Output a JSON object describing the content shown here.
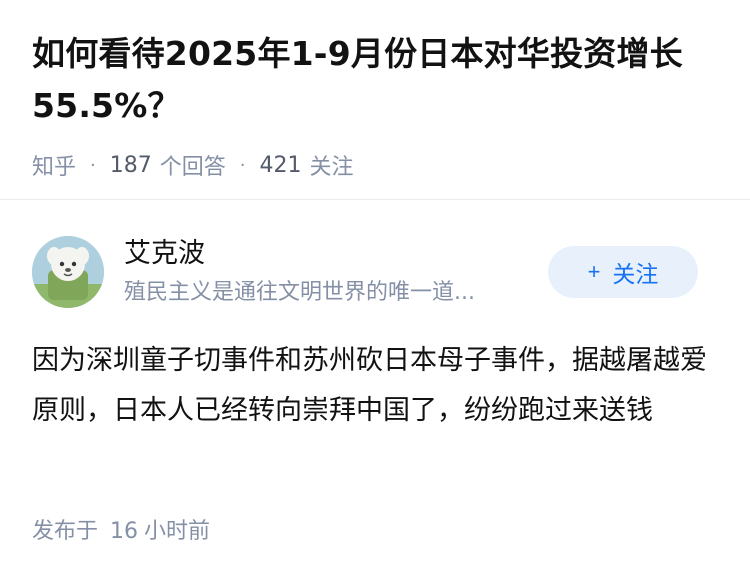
{
  "question": {
    "title": "如何看待2025年1-9月份日本对华投资增长55.5%？",
    "source": "知乎",
    "answer_count": "187",
    "answer_label": "个回答",
    "follower_count": "421",
    "follower_label": "关注",
    "separator": "·"
  },
  "answer": {
    "author": {
      "name": "艾克波",
      "bio": "殖民主义是通往文明世界的唯一道..."
    },
    "follow_button": {
      "icon": "+",
      "label": "关注"
    },
    "content": "因为深圳童子切事件和苏州砍日本母子事件，据越屠越爱原则，日本人已经转向崇拜中国了，纷纷跑过来送钱",
    "time_prefix": "发布于",
    "time_value": "16",
    "time_unit": "小时前"
  },
  "colors": {
    "accent": "#1772f6",
    "follow_bg": "#e8f1fb",
    "meta_gray": "#8590a6",
    "text": "#121212"
  }
}
